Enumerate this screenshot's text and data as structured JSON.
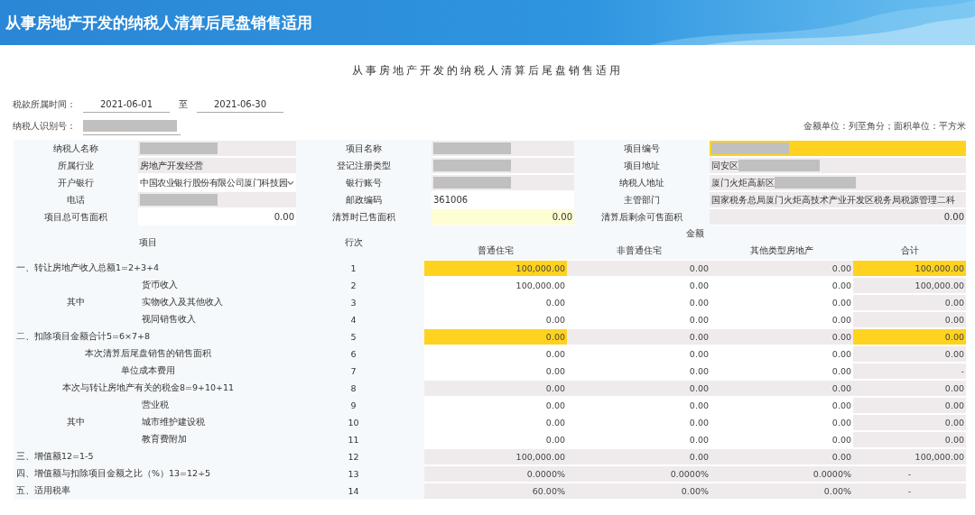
{
  "header": {
    "title": "从事房地产开发的纳税人清算后尾盘销售适用"
  },
  "form_title": "从事房地产开发的纳税人清算后尾盘销售适用",
  "period": {
    "label": "税款所属时间：",
    "start": "2021-06-01",
    "separator": "至",
    "end": "2021-06-30"
  },
  "taxpayer_id": {
    "label": "纳税人识别号：",
    "masked": true
  },
  "unit_note": "金额单位：列至角分；面积单位：平方米",
  "info_rows": [
    [
      {
        "label": "纳税人名称",
        "masked": true,
        "kind": "readonly"
      },
      {
        "label": "项目名称",
        "masked": true,
        "kind": "readonly"
      },
      {
        "label": "项目编号",
        "masked": true,
        "kind": "highlight"
      }
    ],
    [
      {
        "label": "所属行业",
        "value": "房地产开发经营",
        "kind": "readonly"
      },
      {
        "label": "登记注册类型",
        "masked": true,
        "kind": "readonly"
      },
      {
        "label": "项目地址",
        "value": "同安区",
        "masked": true,
        "kind": "readonly"
      }
    ],
    [
      {
        "label": "开户银行",
        "value": "中国农业银行股份有限公司厦门科技园",
        "kind": "select"
      },
      {
        "label": "银行账号",
        "masked": true,
        "kind": "readonly"
      },
      {
        "label": "纳税人地址",
        "value": "厦门火炬高新区",
        "masked": true,
        "kind": "readonly"
      }
    ],
    [
      {
        "label": "电话",
        "masked": true,
        "kind": "readonly"
      },
      {
        "label": "邮政编码",
        "value": "361006",
        "kind": "input"
      },
      {
        "label": "主管部门",
        "value": "国家税务总局厦门火炬高技术产业开发区税务局税源管理二科",
        "kind": "readonly"
      }
    ],
    [
      {
        "label": "项目总可售面积",
        "value": "0.00",
        "kind": "input",
        "right_aligned": true
      },
      {
        "label": "清算时已售面积",
        "value": "0.00",
        "kind": "editable",
        "right_aligned": true
      },
      {
        "label": "清算后剩余可售面积",
        "value": "0.00",
        "kind": "readonly",
        "right_aligned": true
      }
    ]
  ],
  "table": {
    "item_header": "项目",
    "line_header": "行次",
    "amount_header": "金额",
    "amount_columns": [
      "普通住宅",
      "非普通住宅",
      "其他类型房地产",
      "合计"
    ],
    "rows": [
      {
        "kind": "section",
        "label": "一、转让房地产收入总额1=2+3+4",
        "line": "1",
        "cells": [
          {
            "value": "100,000.00",
            "kind": "highlight"
          },
          {
            "value": "0.00",
            "kind": "readonly"
          },
          {
            "value": "0.00",
            "kind": "readonly"
          },
          {
            "value": "100,000.00",
            "kind": "highlight"
          }
        ]
      },
      {
        "kind": "group",
        "label": "其中",
        "items": [
          {
            "label": "货币收入",
            "line": "2",
            "cells": [
              {
                "value": "100,000.00",
                "kind": "input"
              },
              {
                "value": "0.00",
                "kind": "input"
              },
              {
                "value": "0.00",
                "kind": "input"
              },
              {
                "value": "100,000.00",
                "kind": "readonly"
              }
            ]
          },
          {
            "label": "实物收入及其他收入",
            "line": "3",
            "cells": [
              {
                "value": "0.00",
                "kind": "input"
              },
              {
                "value": "0.00",
                "kind": "input"
              },
              {
                "value": "0.00",
                "kind": "input"
              },
              {
                "value": "0.00",
                "kind": "readonly"
              }
            ]
          },
          {
            "label": "视同销售收入",
            "line": "4",
            "cells": [
              {
                "value": "0.00",
                "kind": "input"
              },
              {
                "value": "0.00",
                "kind": "input"
              },
              {
                "value": "0.00",
                "kind": "input"
              },
              {
                "value": "0.00",
                "kind": "readonly"
              }
            ]
          }
        ]
      },
      {
        "kind": "section",
        "label": "二、扣除项目金额合计5=6×7+8",
        "line": "5",
        "cells": [
          {
            "value": "0.00",
            "kind": "highlight"
          },
          {
            "value": "0.00",
            "kind": "readonly"
          },
          {
            "value": "0.00",
            "kind": "readonly"
          },
          {
            "value": "0.00",
            "kind": "highlight"
          }
        ]
      },
      {
        "kind": "center",
        "label": "本次清算后尾盘销售的销售面积",
        "line": "6",
        "cells": [
          {
            "value": "0.00",
            "kind": "input"
          },
          {
            "value": "0.00",
            "kind": "input"
          },
          {
            "value": "0.00",
            "kind": "input"
          },
          {
            "value": "0.00",
            "kind": "readonly"
          }
        ]
      },
      {
        "kind": "center",
        "label": "单位成本费用",
        "line": "7",
        "cells": [
          {
            "value": "0.00",
            "kind": "input"
          },
          {
            "value": "0.00",
            "kind": "input"
          },
          {
            "value": "0.00",
            "kind": "input"
          },
          {
            "value": "-",
            "kind": "readonly"
          }
        ]
      },
      {
        "kind": "center",
        "label": "本次与转让房地产有关的税金8=9+10+11",
        "line": "8",
        "cells": [
          {
            "value": "0.00",
            "kind": "readonly"
          },
          {
            "value": "0.00",
            "kind": "readonly"
          },
          {
            "value": "0.00",
            "kind": "readonly"
          },
          {
            "value": "0.00",
            "kind": "readonly"
          }
        ]
      },
      {
        "kind": "group",
        "label": "其中",
        "items": [
          {
            "label": "营业税",
            "line": "9",
            "cells": [
              {
                "value": "0.00",
                "kind": "input"
              },
              {
                "value": "0.00",
                "kind": "input"
              },
              {
                "value": "0.00",
                "kind": "input"
              },
              {
                "value": "0.00",
                "kind": "readonly"
              }
            ]
          },
          {
            "label": "城市维护建设税",
            "line": "10",
            "cells": [
              {
                "value": "0.00",
                "kind": "input"
              },
              {
                "value": "0.00",
                "kind": "input"
              },
              {
                "value": "0.00",
                "kind": "input"
              },
              {
                "value": "0.00",
                "kind": "readonly"
              }
            ]
          },
          {
            "label": "教育费附加",
            "line": "11",
            "cells": [
              {
                "value": "0.00",
                "kind": "input"
              },
              {
                "value": "0.00",
                "kind": "input"
              },
              {
                "value": "0.00",
                "kind": "input"
              },
              {
                "value": "0.00",
                "kind": "readonly"
              }
            ]
          }
        ]
      },
      {
        "kind": "section",
        "label": "三、增值额12=1-5",
        "line": "12",
        "cells": [
          {
            "value": "100,000.00",
            "kind": "readonly"
          },
          {
            "value": "0.00",
            "kind": "readonly"
          },
          {
            "value": "0.00",
            "kind": "readonly"
          },
          {
            "value": "100,000.00",
            "kind": "readonly"
          }
        ]
      },
      {
        "kind": "section",
        "label": "四、增值额与扣除项目金额之比（%）13=12÷5",
        "line": "13",
        "cells": [
          {
            "value": "0.0000%",
            "kind": "readonly"
          },
          {
            "value": "0.0000%",
            "kind": "readonly"
          },
          {
            "value": "0.0000%",
            "kind": "readonly"
          },
          {
            "value": "-",
            "kind": "readonly",
            "centered": true
          }
        ]
      },
      {
        "kind": "section",
        "label": "五、适用税率",
        "line": "14",
        "cells": [
          {
            "value": "60.00%",
            "kind": "readonly"
          },
          {
            "value": "0.00%",
            "kind": "readonly"
          },
          {
            "value": "0.00%",
            "kind": "readonly"
          },
          {
            "value": "-",
            "kind": "readonly",
            "centered": true
          }
        ]
      }
    ]
  }
}
